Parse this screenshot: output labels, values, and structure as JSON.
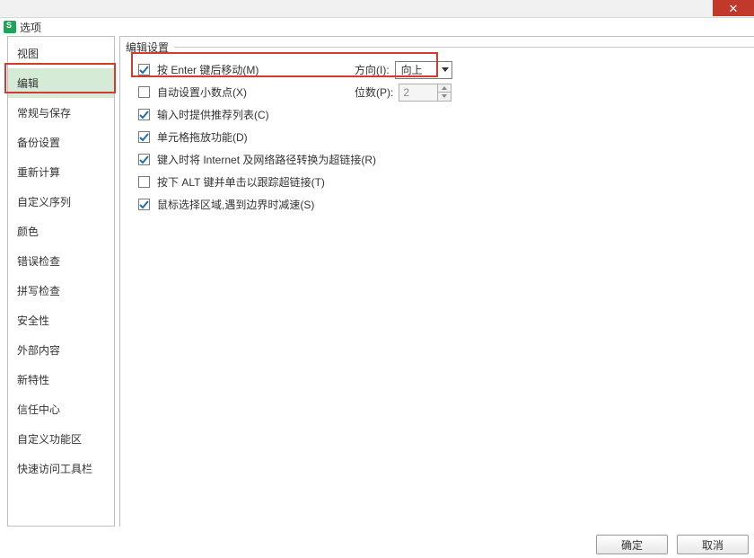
{
  "window": {
    "title": "选项"
  },
  "buttons": {
    "close": "✕",
    "ok": "确定",
    "cancel": "取消"
  },
  "sidebar": {
    "items": [
      "视图",
      "编辑",
      "常规与保存",
      "备份设置",
      "重新计算",
      "自定义序列",
      "颜色",
      "错误检查",
      "拼写检查",
      "安全性",
      "外部内容",
      "新特性",
      "信任中心",
      "自定义功能区",
      "快速访问工具栏"
    ],
    "active_index": 1
  },
  "section": {
    "title": "编辑设置"
  },
  "edit": {
    "enter_move": {
      "checked": true,
      "label": "按 Enter 键后移动(M)",
      "dir_label": "方向(I):",
      "dir_value": "向上"
    },
    "auto_decimal": {
      "checked": false,
      "label": "自动设置小数点(X)",
      "places_label": "位数(P):",
      "places_value": "2"
    },
    "recommend_list": {
      "checked": true,
      "label": "输入时提供推荐列表(C)"
    },
    "drag_drop": {
      "checked": true,
      "label": "单元格拖放功能(D)"
    },
    "internet_link": {
      "checked": true,
      "label": "键入时将 Internet 及网络路径转换为超链接(R)"
    },
    "alt_hyperlink": {
      "checked": false,
      "label": "按下 ALT 键并单击以跟踪超链接(T)"
    },
    "mouse_sel_slow": {
      "checked": true,
      "label": "鼠标选择区域,遇到边界时减速(S)"
    }
  }
}
